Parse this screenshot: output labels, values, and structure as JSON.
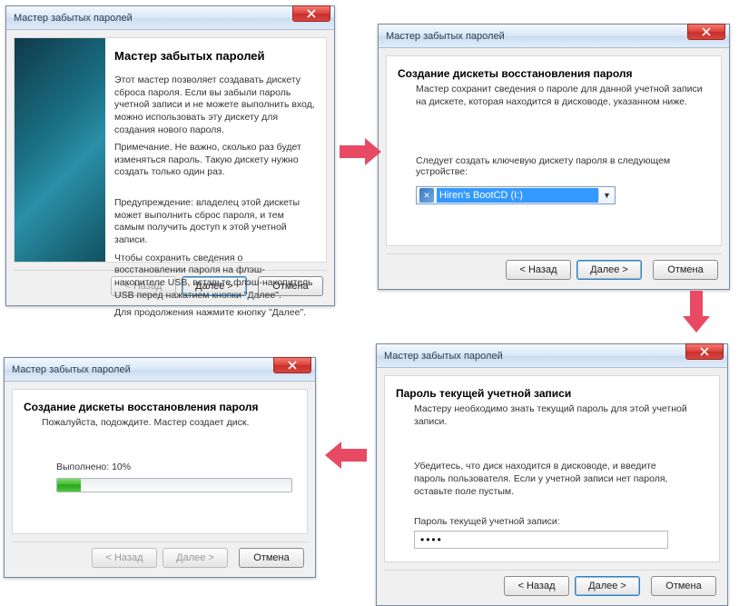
{
  "common": {
    "windowTitle": "Мастер забытых паролей",
    "back": "< Назад",
    "next": "Далее >",
    "cancel": "Отмена"
  },
  "w1": {
    "heading": "Мастер забытых паролей",
    "p1": "Этот мастер позволяет создавать дискету сброса пароля. Если вы забыли пароль учетной записи и не можете выполнить вход, можно использовать эту дискету для создания нового пароля.",
    "p2": "Примечание. Не важно, сколько раз будет изменяться пароль. Такую дискету нужно создать только один раз.",
    "p3": "Предупреждение: владелец этой дискеты может выполнить сброс пароля, и тем самым получить доступ к этой учетной записи.",
    "p4": "Чтобы сохранить сведения о восстановлении пароля на флэш-накопителе USB, вставьте флэш-накопитель USB перед нажатием кнопки \"Далее\".",
    "p5": "Для продолжения нажмите кнопку \"Далее\"."
  },
  "w2": {
    "heading": "Создание дискеты восстановления пароля",
    "sub": "Мастер сохранит сведения о пароле для данной учетной записи на дискете, которая находится в дисководе, указанном ниже.",
    "label": "Следует создать ключевую дискету пароля в следующем устройстве:",
    "driveText": "Hiren's BootCD (I:)"
  },
  "w3": {
    "heading": "Пароль текущей учетной записи",
    "sub": "Мастеру необходимо знать текущий пароль для этой учетной записи.",
    "hint": "Убедитесь, что диск находится в дисководе, и введите пароль пользователя. Если у учетной записи нет пароля, оставьте поле пустым.",
    "label": "Пароль текущей учетной записи:",
    "value": "••••"
  },
  "w4": {
    "heading": "Создание дискеты восстановления пароля",
    "sub": "Пожалуйста, подождите. Мастер создает диск.",
    "progressLabel": "Выполнено: 10%",
    "progressPct": 10
  }
}
